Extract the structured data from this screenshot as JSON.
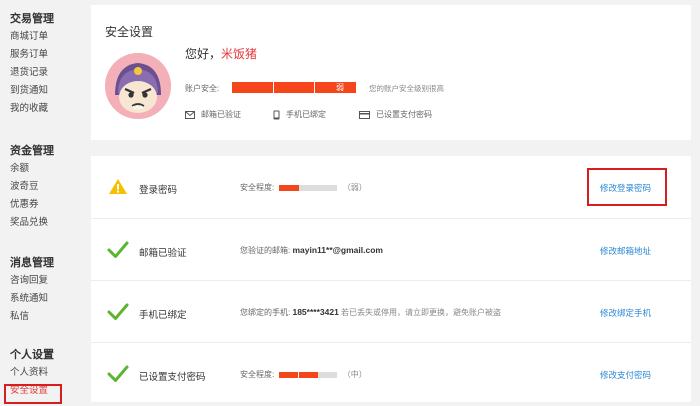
{
  "sidebar": {
    "groups": [
      {
        "title": "交易管理",
        "items": [
          "商城订单",
          "服务订单",
          "退货记录",
          "到货通知",
          "我的收藏"
        ]
      },
      {
        "title": "资金管理",
        "items": [
          "余额",
          "波奇豆",
          "优惠券",
          "奖品兑换"
        ]
      },
      {
        "title": "消息管理",
        "items": [
          "咨询回复",
          "系统通知",
          "私信"
        ]
      },
      {
        "title": "个人设置",
        "items": [
          "个人资料",
          "安全设置"
        ]
      }
    ],
    "active_item": "安全设置"
  },
  "profile": {
    "title": "安全设置",
    "greeting": "您好，",
    "username": "米饭猪",
    "security_label": "账户安全:",
    "security_level": "弱",
    "security_tip": "您的账户安全级别很高",
    "badges": [
      {
        "icon": "mail-icon",
        "label": "邮箱已验证"
      },
      {
        "icon": "phone-icon",
        "label": "手机已绑定"
      },
      {
        "icon": "card-icon",
        "label": "已设置支付密码"
      }
    ]
  },
  "rows": [
    {
      "icon": "warning-icon",
      "name": "登录密码",
      "info_label": "安全程度:",
      "strength_fraction": 0.33,
      "strength_text": "（弱）",
      "action": "修改登录密码",
      "highlighted": true
    },
    {
      "icon": "check-icon",
      "name": "邮箱已验证",
      "info_label": "您验证的邮箱:",
      "info_value": "mayin11**@gmail.com",
      "action": "修改邮箱地址"
    },
    {
      "icon": "check-icon",
      "name": "手机已绑定",
      "info_label": "您绑定的手机:",
      "info_value": "185****3421",
      "info_note": "若已丢失或停用，请立即更换，避免账户被盗",
      "action": "修改绑定手机"
    },
    {
      "icon": "check-icon",
      "name": "已设置支付密码",
      "info_label": "安全程度:",
      "strength_fraction": 0.66,
      "strength_text": "（中）",
      "action": "修改支付密码"
    }
  ],
  "colors": {
    "accent": "#e4393c",
    "link": "#2a87d4",
    "bar": "#f5461b",
    "check": "#5cb531",
    "warning": "#f5c000"
  }
}
